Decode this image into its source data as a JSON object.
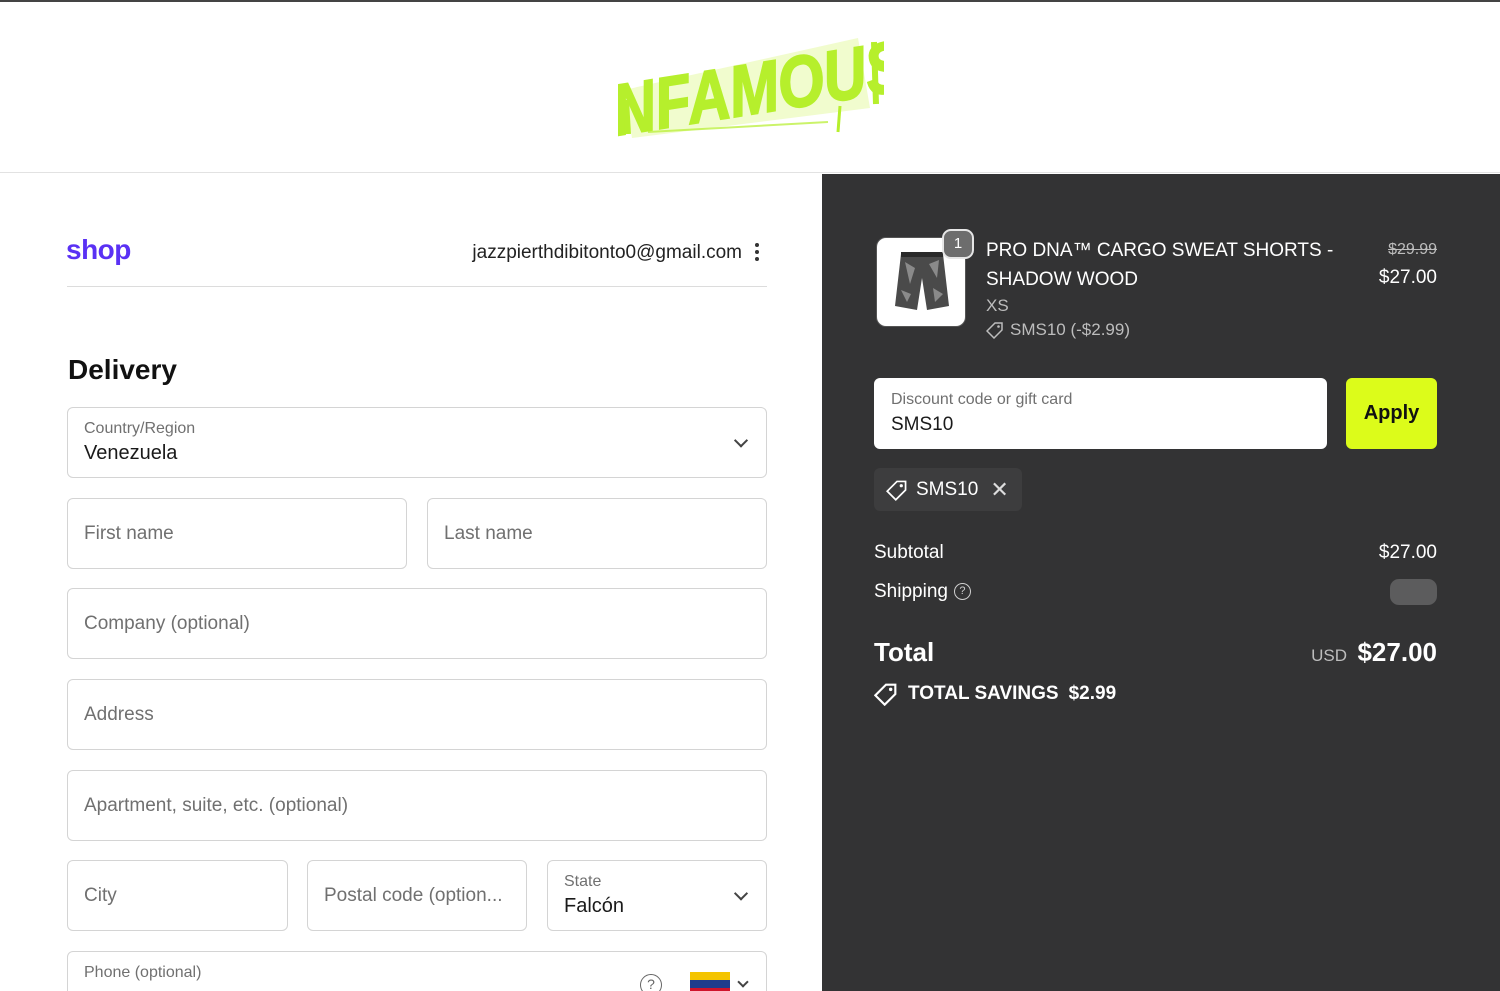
{
  "brand": {
    "logo_text": "INFAMOUS"
  },
  "account": {
    "shop_label": "shop",
    "email": "jazzpierthdibitonto0@gmail.com"
  },
  "delivery": {
    "title": "Delivery",
    "country": {
      "label": "Country/Region",
      "value": "Venezuela"
    },
    "first_name": {
      "placeholder": "First name"
    },
    "last_name": {
      "placeholder": "Last name"
    },
    "company": {
      "placeholder": "Company (optional)"
    },
    "address": {
      "placeholder": "Address"
    },
    "apartment": {
      "placeholder": "Apartment, suite, etc. (optional)"
    },
    "city": {
      "placeholder": "City"
    },
    "postal": {
      "placeholder": "Postal code (option..."
    },
    "state": {
      "label": "State",
      "value": "Falcón"
    },
    "phone": {
      "label": "Phone (optional)",
      "help": "?"
    }
  },
  "summary": {
    "product": {
      "quantity": "1",
      "name": "PRO DNA™ CARGO SWEAT SHORTS - SHADOW WOOD",
      "variant": "XS",
      "discount": "SMS10 (-$2.99)",
      "price_original": "$29.99",
      "price": "$27.00"
    },
    "discount_field": {
      "label": "Discount code or gift card",
      "value": "SMS10"
    },
    "apply_label": "Apply",
    "applied_code": "SMS10",
    "remove_glyph": "✕",
    "subtotal_label": "Subtotal",
    "subtotal_value": "$27.00",
    "shipping_label": "Shipping",
    "shipping_help": "?",
    "total_label": "Total",
    "total_currency": "USD",
    "total_value": "$27.00",
    "savings_label": "TOTAL SAVINGS",
    "savings_value": "$2.99"
  },
  "colors": {
    "accent": "#dcfc1a",
    "shop_purple": "#5a31f4",
    "summary_bg": "#333334"
  }
}
